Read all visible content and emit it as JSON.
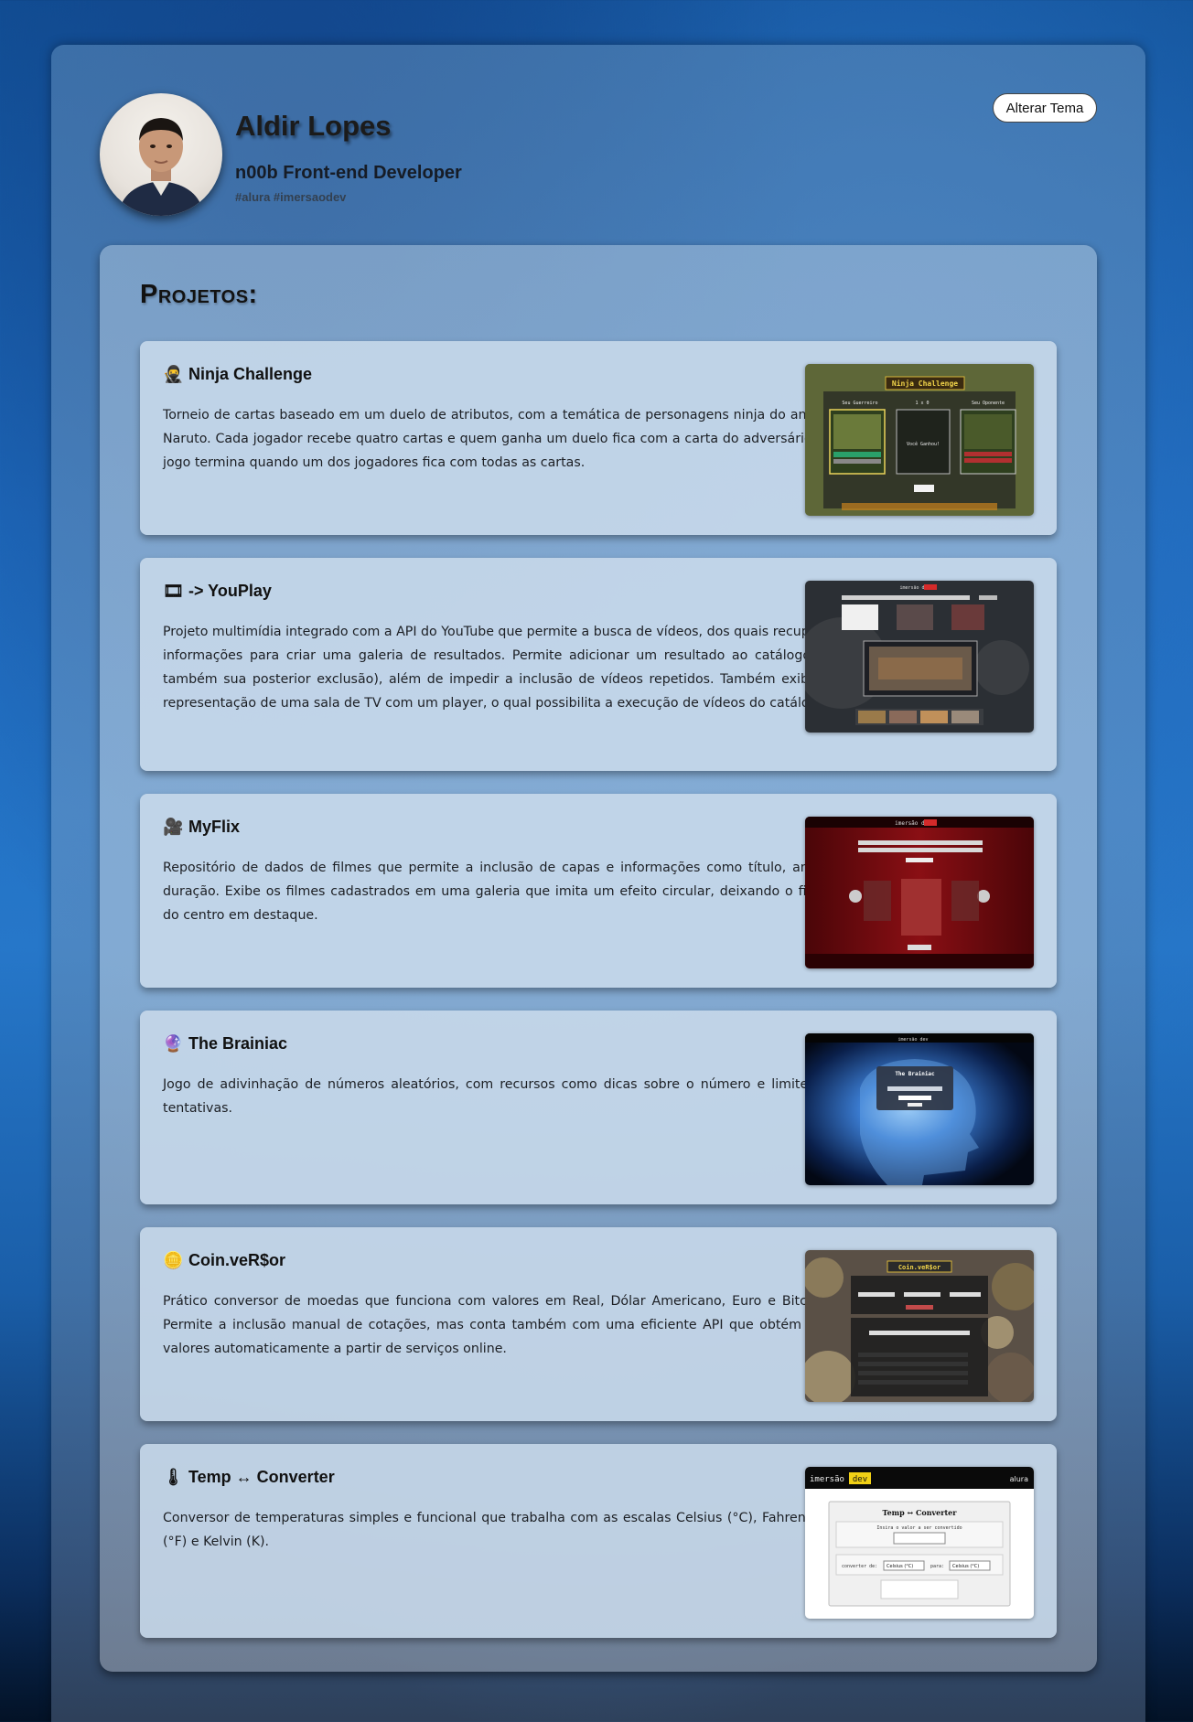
{
  "profile": {
    "name": "Aldir Lopes",
    "role": "n00b Front-end Developer",
    "tags": "#alura #imersaodev"
  },
  "theme_button": "Alterar Tema",
  "projects_title": "Projetos:",
  "projects": [
    {
      "icon": "ninja-icon",
      "icon_glyph": "🥷",
      "title": "Ninja Challenge",
      "description": "Torneio de cartas baseado em um duelo de atributos, com a temática de personagens ninja do anime Naruto. Cada jogador recebe quatro cartas e quem ganha um duelo fica com a carta do adversário. O jogo termina quando um dos jogadores fica com todas as cartas.",
      "thumb_texts": [
        "Ninja Challenge",
        "Seu Guerreiro",
        "1 x 0",
        "Seu Oponente",
        "Você Ganhou!"
      ]
    },
    {
      "icon": "film-icon",
      "icon_glyph": "🎞",
      "title": "-> YouPlay",
      "description": "Projeto multimídia integrado com a API do YouTube que permite a busca de vídeos, dos quais recupera informações para criar uma galeria de resultados. Permite adicionar um resultado ao catálogo (e também sua posterior exclusão), além de impedir a inclusão de vídeos repetidos. Também exibe a representação de uma sala de TV com um player, o qual possibilita a execução de vídeos do catálogo.",
      "thumb_texts": [
        "imersão dev"
      ]
    },
    {
      "icon": "movie-camera-icon",
      "icon_glyph": "🎥",
      "title": "MyFlix",
      "description": "Repositório de dados de filmes que permite a inclusão de capas e informações como título, ano e duração. Exibe os filmes cadastrados em uma galeria que imita um efeito circular, deixando o filme do centro em destaque.",
      "thumb_texts": [
        "imersão dev"
      ]
    },
    {
      "icon": "crystal-ball-icon",
      "icon_glyph": "🔮",
      "title": "The Brainiac",
      "description": "Jogo de adivinhação de números aleatórios, com recursos como dicas sobre o número e limite de tentativas.",
      "thumb_texts": [
        "imersão dev",
        "The Brainiac"
      ]
    },
    {
      "icon": "coin-icon",
      "icon_glyph": "🪙",
      "title": "Coin.veR$or",
      "description": "Prático conversor de moedas que funciona com valores em Real, Dólar Americano, Euro e Bitcoin. Permite a inclusão manual de cotações, mas conta também com uma eficiente API que obtém tais valores automaticamente a partir de serviços online.",
      "thumb_texts": [
        "Coin.veR$or"
      ]
    },
    {
      "icon": "thermometer-icon",
      "icon_glyph": "🌡",
      "title": "Temp ↔ Converter",
      "description": "Conversor de temperaturas simples e funcional que trabalha com as escalas Celsius (°C), Fahrenheit (°F) e Kelvin (K).",
      "thumb_texts": [
        "imersão",
        "dev",
        "alura",
        "Temp ↔ Converter",
        "Insira o valor a ser convertido",
        "converter de:",
        "Celsius (°C)",
        "para:",
        "Celsius (°C)"
      ]
    }
  ]
}
